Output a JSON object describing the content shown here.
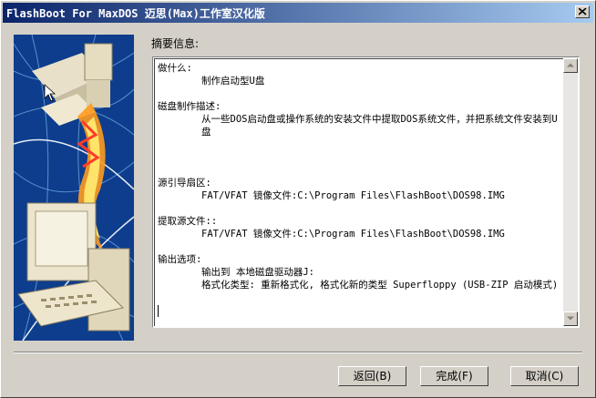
{
  "window": {
    "title": "FlashBoot For MaxDOS 迈思(Max)工作室汉化版"
  },
  "summary_label": "摘要信息:",
  "summary_lines": [
    {
      "text": "做什么:",
      "indent": false
    },
    {
      "text": "制作启动型U盘",
      "indent": true
    },
    {
      "text": "",
      "indent": false
    },
    {
      "text": "磁盘制作描述:",
      "indent": false
    },
    {
      "text": "从一些DOS启动盘或操作系统的安装文件中提取DOS系统文件，并把系统文件安装到U盘",
      "indent": true
    },
    {
      "text": "",
      "indent": false
    },
    {
      "text": "",
      "indent": false
    },
    {
      "text": "",
      "indent": false
    },
    {
      "text": "源引导扇区:",
      "indent": false
    },
    {
      "text": "FAT/VFAT 镜像文件:C:\\Program Files\\FlashBoot\\DOS98.IMG",
      "indent": true
    },
    {
      "text": "",
      "indent": false
    },
    {
      "text": "提取源文件::",
      "indent": false
    },
    {
      "text": "FAT/VFAT 镜像文件:C:\\Program Files\\FlashBoot\\DOS98.IMG",
      "indent": true
    },
    {
      "text": "",
      "indent": false
    },
    {
      "text": "输出选项:",
      "indent": false
    },
    {
      "text": "输出到 本地磁盘驱动器J:",
      "indent": true
    },
    {
      "text": "格式化类型: 重新格式化, 格式化新的类型 Superfloppy (USB-ZIP 启动模式)",
      "indent": true
    }
  ],
  "buttons": {
    "back": "返回(B)",
    "finish": "完成(F)",
    "cancel": "取消(C)"
  },
  "icons": {
    "close": "close-icon",
    "scroll_up": "scroll-up-arrow-icon",
    "scroll_down": "scroll-down-arrow-icon",
    "art": "wizard-illustration"
  }
}
